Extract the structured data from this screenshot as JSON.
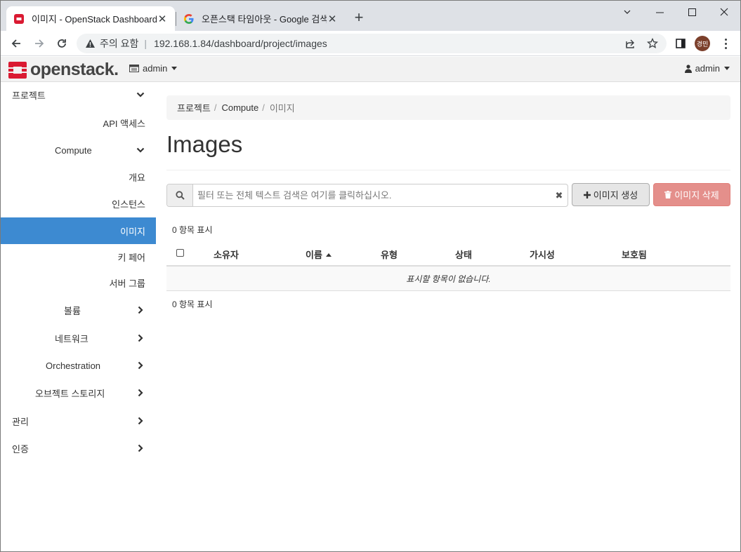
{
  "browser": {
    "tabs": [
      {
        "title": "이미지 - OpenStack Dashboard",
        "close": "✕"
      },
      {
        "title": "오픈스택 타임아웃 - Google 검색",
        "close": "✕"
      }
    ],
    "new_tab": "+",
    "window_controls": {
      "minimize": "—",
      "maximize": "☐",
      "close": "✕"
    },
    "security_label": "주의 요함",
    "separator": "|",
    "url": "192.168.1.84/dashboard/project/images",
    "profile_initials": "경민"
  },
  "header": {
    "logo_text": "openstack.",
    "project_selector": "admin",
    "user_menu": "admin"
  },
  "sidebar": {
    "items": [
      {
        "label": "프로젝트"
      },
      {
        "label": "API 액세스"
      },
      {
        "label": "Compute"
      },
      {
        "label": "개요"
      },
      {
        "label": "인스턴스"
      },
      {
        "label": "이미지"
      },
      {
        "label": "키 페어"
      },
      {
        "label": "서버 그룹"
      },
      {
        "label": "볼륨"
      },
      {
        "label": "네트워크"
      },
      {
        "label": "Orchestration"
      },
      {
        "label": "오브젝트 스토리지"
      },
      {
        "label": "관리"
      },
      {
        "label": "인증"
      }
    ]
  },
  "main": {
    "breadcrumb": [
      "프로젝트",
      "Compute",
      "이미지"
    ],
    "breadcrumb_sep": "/",
    "page_title": "Images",
    "search_placeholder": "필터 또는 전체 텍스트 검색은 여기를 클릭하십시오.",
    "clear_glyph": "✖",
    "create_button": "이미지 생성",
    "delete_button": "이미지 삭제",
    "count_top": "0 항목 표시",
    "count_bottom": "0 항목 표시",
    "columns": [
      "소유자",
      "이름",
      "유형",
      "상태",
      "가시성",
      "보호됨"
    ],
    "sorted_column": "이름",
    "empty_message": "표시할 항목이 없습니다."
  },
  "colors": {
    "accent": "#3d8ad1",
    "danger": "#e48f8b",
    "brand_red": "#da1a32"
  }
}
